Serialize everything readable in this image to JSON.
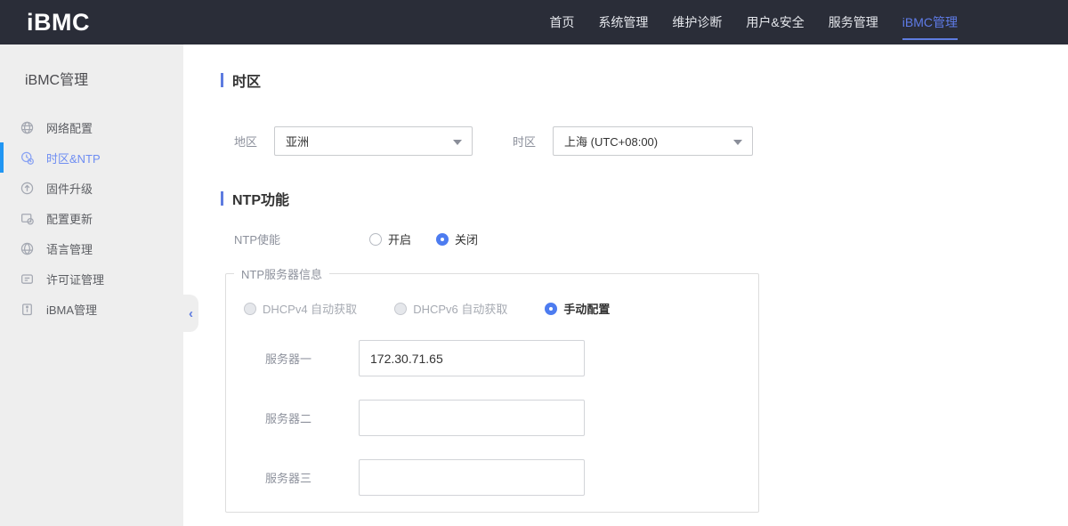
{
  "header": {
    "logo": "iBMC",
    "nav": [
      {
        "label": "首页",
        "active": false
      },
      {
        "label": "系统管理",
        "active": false
      },
      {
        "label": "维护诊断",
        "active": false
      },
      {
        "label": "用户&安全",
        "active": false
      },
      {
        "label": "服务管理",
        "active": false
      },
      {
        "label": "iBMC管理",
        "active": true
      }
    ]
  },
  "sidebar": {
    "title": "iBMC管理",
    "items": [
      {
        "label": "网络配置",
        "icon": "network-icon",
        "active": false
      },
      {
        "label": "时区&NTP",
        "icon": "timezone-icon",
        "active": true
      },
      {
        "label": "固件升级",
        "icon": "firmware-upgrade-icon",
        "active": false
      },
      {
        "label": "配置更新",
        "icon": "config-update-icon",
        "active": false
      },
      {
        "label": "语言管理",
        "icon": "language-icon",
        "active": false
      },
      {
        "label": "许可证管理",
        "icon": "license-icon",
        "active": false
      },
      {
        "label": "iBMA管理",
        "icon": "ibma-icon",
        "active": false
      }
    ],
    "collapse_icon": "‹"
  },
  "timezone_section": {
    "title": "时区",
    "region_label": "地区",
    "region_value": "亚洲",
    "timezone_label": "时区",
    "timezone_value": "上海 (UTC+08:00)"
  },
  "ntp_section": {
    "title": "NTP功能",
    "enable_label": "NTP使能",
    "enable_options": [
      {
        "label": "开启",
        "checked": false
      },
      {
        "label": "关闭",
        "checked": true
      }
    ],
    "server_group": {
      "legend": "NTP服务器信息",
      "mode_options": [
        {
          "label": "DHCPv4 自动获取",
          "checked": false,
          "disabled": true
        },
        {
          "label": "DHCPv6 自动获取",
          "checked": false,
          "disabled": true
        },
        {
          "label": "手动配置",
          "checked": true,
          "disabled": false
        }
      ],
      "servers": [
        {
          "label": "服务器一",
          "value": "172.30.71.65"
        },
        {
          "label": "服务器二",
          "value": ""
        },
        {
          "label": "服务器三",
          "value": ""
        }
      ]
    }
  },
  "colors": {
    "topbar_bg": "#2a2d38",
    "accent_blue": "#5e7ce0",
    "active_sidebar_bar": "#2196f3",
    "radio_checked": "#4d7cf0",
    "sidebar_bg": "#eeeeee"
  }
}
